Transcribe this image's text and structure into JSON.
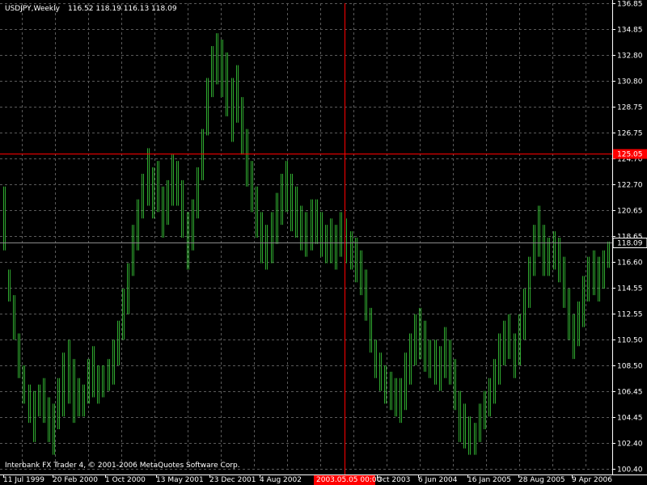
{
  "header": {
    "symbol": "USDJPY,Weekly",
    "ohlc": "116.52 118.19 116.13 118.09"
  },
  "footer": {
    "copyright": "Interbank FX Trader 4, © 2001-2006 MetaQuotes Software Corp."
  },
  "colors": {
    "background": "#000000",
    "candles": "#2fa82f",
    "grid": "#5a5a5a",
    "crosshair": "#ff0000",
    "current_price_line": "#8a8a8a"
  },
  "crosshair": {
    "price_label": "125.05",
    "date_label": "2003.05.05 00:00"
  },
  "current_price": {
    "label": "118.09",
    "value": 118.09
  },
  "chart_data": {
    "type": "bar",
    "instrument": "USDJPY",
    "timeframe": "Weekly",
    "ylim": [
      100.4,
      136.85
    ],
    "y_ticks": [
      "136.85",
      "134.85",
      "132.80",
      "130.80",
      "128.75",
      "126.75",
      "124.70",
      "122.70",
      "120.65",
      "118.65",
      "116.60",
      "114.55",
      "112.55",
      "110.50",
      "108.50",
      "106.45",
      "104.45",
      "102.40",
      "100.40"
    ],
    "x_ticks": [
      "11 Jul 1999",
      "20 Feb 2000",
      "1 Oct 2000",
      "13 May 2001",
      "23 Dec 2001",
      "4 Aug 2002",
      "Oct 2003",
      "6 Jun 2004",
      "16 Jan 2005",
      "28 Aug 2005",
      "9 Apr 2006"
    ],
    "grid": true,
    "series": [
      {
        "values": [
          [
            122.5,
            117.5
          ],
          [
            116.0,
            113.5
          ],
          [
            114.0,
            110.5
          ],
          [
            111.0,
            107.5
          ],
          [
            108.5,
            105.5
          ],
          [
            107.0,
            104.0
          ],
          [
            106.5,
            102.5
          ],
          [
            107.0,
            104.5
          ],
          [
            107.5,
            104.0
          ],
          [
            106.0,
            102.5
          ],
          [
            105.5,
            101.5
          ],
          [
            107.5,
            103.5
          ],
          [
            109.5,
            104.5
          ],
          [
            110.5,
            105.5
          ],
          [
            109.0,
            104.0
          ],
          [
            107.5,
            104.5
          ],
          [
            107.0,
            104.5
          ],
          [
            109.0,
            105.5
          ],
          [
            110.0,
            106.0
          ],
          [
            108.5,
            105.5
          ],
          [
            108.5,
            106.0
          ],
          [
            109.0,
            106.5
          ],
          [
            110.5,
            107.0
          ],
          [
            112.0,
            108.5
          ],
          [
            114.5,
            110.5
          ],
          [
            116.5,
            112.5
          ],
          [
            119.5,
            115.5
          ],
          [
            121.5,
            117.5
          ],
          [
            123.5,
            120.0
          ],
          [
            125.5,
            121.0
          ],
          [
            124.0,
            120.0
          ],
          [
            124.5,
            120.5
          ],
          [
            122.5,
            118.5
          ],
          [
            123.0,
            119.5
          ],
          [
            125.0,
            121.0
          ],
          [
            124.5,
            121.0
          ],
          [
            123.0,
            118.5
          ],
          [
            120.5,
            116.0
          ],
          [
            121.5,
            117.5
          ],
          [
            124.0,
            120.0
          ],
          [
            127.0,
            123.0
          ],
          [
            131.0,
            126.5
          ],
          [
            133.5,
            129.5
          ],
          [
            134.5,
            130.5
          ],
          [
            134.0,
            129.5
          ],
          [
            133.0,
            128.0
          ],
          [
            131.0,
            126.0
          ],
          [
            132.0,
            127.5
          ],
          [
            129.5,
            125.0
          ],
          [
            127.0,
            122.5
          ],
          [
            124.5,
            120.5
          ],
          [
            122.5,
            118.5
          ],
          [
            120.5,
            116.5
          ],
          [
            119.5,
            116.0
          ],
          [
            120.5,
            116.5
          ],
          [
            122.0,
            118.0
          ],
          [
            123.5,
            119.5
          ],
          [
            124.5,
            120.5
          ],
          [
            123.5,
            119.0
          ],
          [
            122.5,
            118.5
          ],
          [
            121.0,
            117.5
          ],
          [
            120.5,
            117.0
          ],
          [
            121.5,
            117.5
          ],
          [
            121.5,
            118.0
          ],
          [
            120.5,
            117.0
          ],
          [
            119.5,
            116.5
          ],
          [
            120.0,
            116.5
          ],
          [
            119.5,
            116.0
          ],
          [
            120.5,
            117.0
          ],
          [
            120.0,
            116.5
          ],
          [
            119.0,
            116.0
          ],
          [
            118.5,
            115.0
          ],
          [
            117.5,
            114.0
          ],
          [
            116.0,
            112.0
          ],
          [
            113.0,
            109.5
          ],
          [
            110.5,
            107.5
          ],
          [
            109.5,
            106.5
          ],
          [
            108.5,
            105.5
          ],
          [
            108.0,
            105.0
          ],
          [
            107.5,
            104.5
          ],
          [
            107.5,
            104.0
          ],
          [
            109.5,
            105.0
          ],
          [
            111.0,
            107.0
          ],
          [
            112.5,
            108.5
          ],
          [
            113.0,
            109.0
          ],
          [
            112.0,
            108.0
          ],
          [
            110.5,
            107.5
          ],
          [
            110.5,
            107.0
          ],
          [
            110.0,
            106.5
          ],
          [
            111.5,
            107.5
          ],
          [
            110.5,
            107.0
          ],
          [
            109.0,
            105.0
          ],
          [
            106.5,
            102.5
          ],
          [
            105.5,
            102.0
          ],
          [
            104.5,
            101.5
          ],
          [
            104.0,
            101.5
          ],
          [
            105.5,
            102.5
          ],
          [
            106.5,
            103.5
          ],
          [
            107.5,
            104.5
          ],
          [
            109.0,
            105.5
          ],
          [
            111.0,
            107.0
          ],
          [
            112.0,
            108.5
          ],
          [
            112.5,
            109.0
          ],
          [
            111.0,
            107.5
          ],
          [
            112.5,
            108.5
          ],
          [
            114.5,
            110.5
          ],
          [
            117.0,
            113.0
          ],
          [
            119.5,
            115.5
          ],
          [
            121.0,
            117.0
          ],
          [
            119.5,
            115.5
          ],
          [
            118.5,
            115.5
          ],
          [
            119.0,
            116.0
          ],
          [
            118.5,
            115.0
          ],
          [
            117.0,
            113.0
          ],
          [
            114.5,
            110.5
          ],
          [
            112.5,
            109.0
          ],
          [
            113.5,
            110.0
          ],
          [
            115.5,
            111.5
          ],
          [
            117.0,
            113.5
          ],
          [
            117.5,
            114.0
          ],
          [
            117.0,
            113.5
          ],
          [
            117.5,
            114.5
          ],
          [
            118.19,
            116.13
          ]
        ]
      }
    ]
  }
}
